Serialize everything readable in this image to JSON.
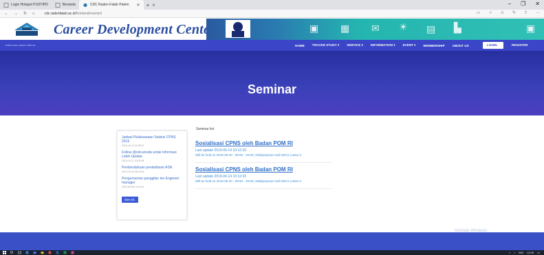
{
  "browser": {
    "tabs": [
      {
        "label": "Login Hotspot PUSTIPD"
      },
      {
        "label": "Beranda"
      },
      {
        "label": "CDC Raden Fatah Palem"
      }
    ],
    "new_tab": "+",
    "tab_dropdown": "∨",
    "window_controls": {
      "minimize": "–",
      "maximize": "❐",
      "close": "✕"
    },
    "url_host": "cdc.radenfatah.ac.id",
    "url_path": "/frontend/eventcti"
  },
  "site": {
    "brand": "Career Development Center",
    "tagline": "build your career with us"
  },
  "nav": {
    "items": [
      "HOME",
      "TRACER STUDY ▾",
      "SERVICE ▾",
      "INFORMATION ▾",
      "EVENT ▾",
      "MEMBERSHIP",
      "ABOUT US"
    ],
    "login": "LOGIN",
    "register": "REGISTER"
  },
  "hero": {
    "title": "Seminar"
  },
  "sidebar": {
    "items": [
      {
        "title": "Jadwal Pelaksanaan Seleksi CPNS 2019",
        "date": "2019-10-12 20:08:37"
      },
      {
        "title": "Follow @cdcuinrafa untuk Informasi Lebih Update",
        "date": "2019-10-11 20:03:08"
      },
      {
        "title": "Pemberitahuan pendaftaran ASN",
        "date": "2019-10-04 08:44:03"
      },
      {
        "title": "Pengumuman panggilan tes Engineer manager",
        "date": "2019-06-08 10:40:37"
      }
    ],
    "see_all": "See all.."
  },
  "events": {
    "heading": "Seminar list",
    "items": [
      {
        "title": "Sosialisasi CPNS oleh Badan POM RI",
        "updated": "Last update 2019-06-14 10:12:33",
        "held": "Will be held on 2019-06-20 - 09:00 - 15:00 | Multipurpose Hall CBCS Lantai 3"
      },
      {
        "title": "Sosialisasi CPNS oleh Badan POM RI",
        "updated": "Last update 2019-06-14 10:12:33",
        "held": "Will be held on 2019-06-20 - 09:00 - 15:00 | Multipurpose Hall CBCS Lantai 3"
      }
    ]
  },
  "watermark": {
    "title": "Activate Windows",
    "sub": "Go to Settings to activate Windows."
  },
  "tray": {
    "lang": "IND",
    "time": "13:29"
  },
  "colors": {
    "nav": "#3a45c8",
    "hero_top": "#272fa0",
    "hero_bottom": "#4b3fc0",
    "link": "#2e6ec7",
    "footer": "#3a50c6"
  }
}
